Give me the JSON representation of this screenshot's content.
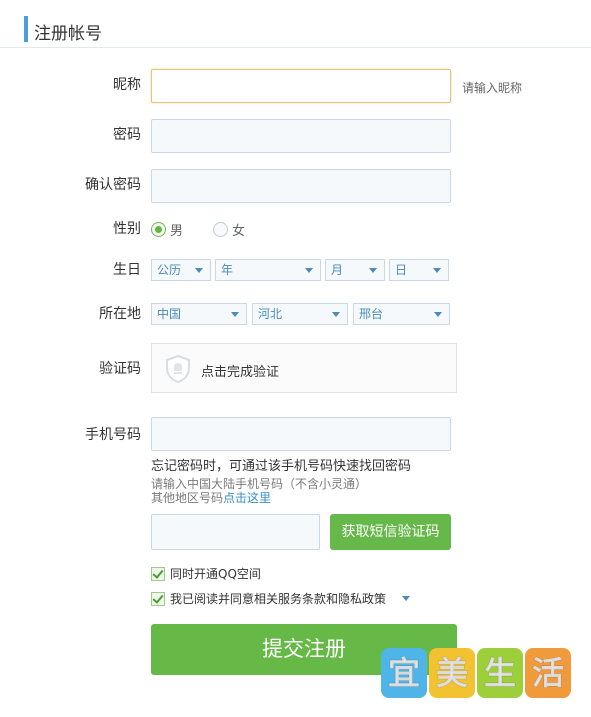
{
  "header": {
    "title": "注册帐号"
  },
  "nickname": {
    "label": "昵称",
    "value": "",
    "hint": "请输入昵称"
  },
  "password": {
    "label": "密码",
    "value": ""
  },
  "confirm_password": {
    "label": "确认密码",
    "value": ""
  },
  "gender": {
    "label": "性别",
    "options": [
      "男",
      "女"
    ],
    "selected": "男"
  },
  "birthday": {
    "label": "生日",
    "calendar": "公历",
    "year": "年",
    "month": "月",
    "day": "日"
  },
  "location": {
    "label": "所在地",
    "country": "中国",
    "province": "河北",
    "city": "邢台"
  },
  "captcha": {
    "label": "验证码",
    "text": "点击完成验证"
  },
  "phone": {
    "label": "手机号码",
    "value": "",
    "note": "忘记密码时，可通过该手机号码快速找回密码",
    "sub_note": "请输入中国大陆手机号码（不含小灵通）",
    "other_prefix": "其他地区号码",
    "other_link": "点击这里"
  },
  "sms": {
    "value": "",
    "button": "获取短信验证码"
  },
  "options": {
    "qzone": "同时开通QQ空间",
    "agree": "我已阅读并同意相关服务条款和隐私政策"
  },
  "submit": {
    "label": "提交注册"
  },
  "watermark": {
    "chars": [
      "宜",
      "美",
      "生",
      "活"
    ]
  },
  "colors": {
    "accent_blue": "#4a9fd6",
    "button_green": "#66b847",
    "focus_border": "#e2c47c",
    "link": "#3a8fc7"
  }
}
